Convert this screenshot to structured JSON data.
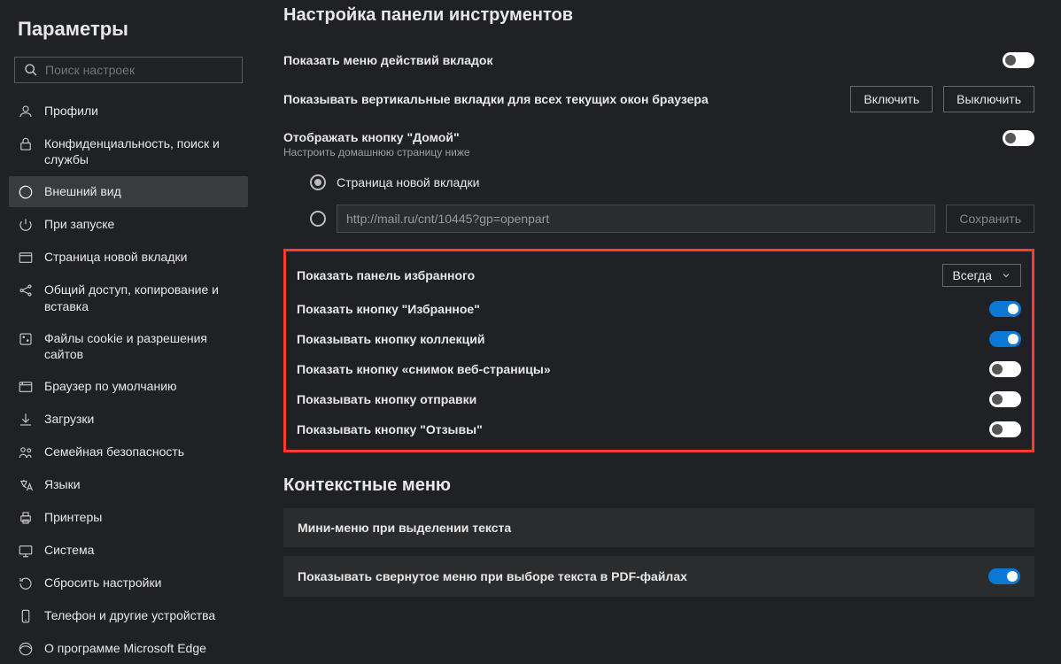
{
  "sidebar": {
    "title": "Параметры",
    "search_placeholder": "Поиск настроек",
    "items": [
      {
        "label": "Профили"
      },
      {
        "label": "Конфиденциальность, поиск и службы"
      },
      {
        "label": "Внешний вид"
      },
      {
        "label": "При запуске"
      },
      {
        "label": "Страница новой вкладки"
      },
      {
        "label": "Общий доступ, копирование и вставка"
      },
      {
        "label": "Файлы cookie и разрешения сайтов"
      },
      {
        "label": "Браузер по умолчанию"
      },
      {
        "label": "Загрузки"
      },
      {
        "label": "Семейная безопасность"
      },
      {
        "label": "Языки"
      },
      {
        "label": "Принтеры"
      },
      {
        "label": "Система"
      },
      {
        "label": "Сбросить настройки"
      },
      {
        "label": "Телефон и другие устройства"
      },
      {
        "label": "О программе Microsoft Edge"
      }
    ]
  },
  "main": {
    "toolbar_title": "Настройка панели инструментов",
    "row_tab_menu": "Показать меню действий вкладок",
    "row_vtabs": "Показывать вертикальные вкладки для всех текущих окон браузера",
    "btn_enable": "Включить",
    "btn_disable": "Выключить",
    "row_home": "Отображать кнопку \"Домой\"",
    "row_home_sub": "Настроить домашнюю страницу ниже",
    "radio_newtab": "Страница новой вкладки",
    "url_value": "http://mail.ru/cnt/10445?gp=openpart",
    "btn_save": "Сохранить",
    "fav_panel": "Показать панель избранного",
    "fav_dropdown": "Всегда",
    "fav_button": "Показать кнопку \"Избранное\"",
    "collections_button": "Показывать кнопку коллекций",
    "screenshot_button": "Показать кнопку «снимок веб-страницы»",
    "send_button": "Показывать кнопку отправки",
    "feedback_button": "Показывать кнопку \"Отзывы\"",
    "context_title": "Контекстные меню",
    "card_mini": "Мини-меню при выделении текста",
    "card_pdf": "Показывать свернутое меню при выборе текста в PDF-файлах"
  }
}
